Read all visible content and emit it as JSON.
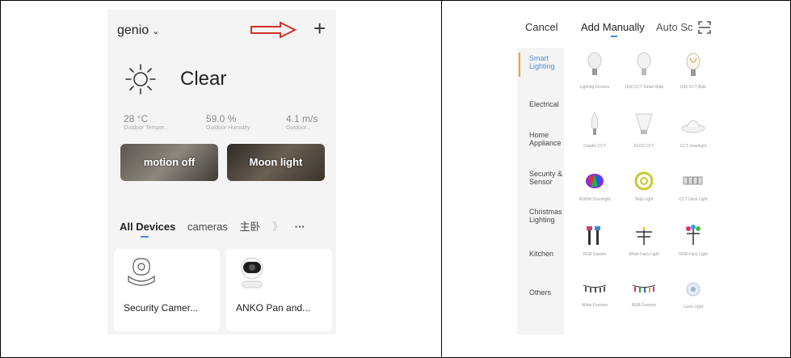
{
  "left_phone": {
    "home_name": "genio",
    "add_icon": "plus-icon",
    "annotation_arrow_color": "#d0302a",
    "weather": {
      "icon": "sun-icon",
      "condition": "Clear"
    },
    "stats": [
      {
        "value": "28 °C",
        "label": "Outdoor Temper..."
      },
      {
        "value": "59.0 %",
        "label": "Outdoor Humidity"
      },
      {
        "value": "4.1 m/s",
        "label": "Outdoor..."
      }
    ],
    "scenes": [
      {
        "label": "motion off"
      },
      {
        "label": "Moon light"
      }
    ],
    "tabs": [
      "All Devices",
      "cameras",
      "主卧",
      "》",
      "···"
    ],
    "accent_color": "#3a8dde",
    "devices": [
      {
        "name": "Security Camer...",
        "icon": "camera-icon"
      },
      {
        "name": "ANKO Pan and...",
        "icon": "pan-tilt-camera-icon"
      }
    ]
  },
  "right_phone": {
    "top_bar": {
      "cancel": "Cancel",
      "active_tab": "Add Manually",
      "other_tab": "Auto Sc",
      "scan_icon": "scan-icon"
    },
    "categories": [
      {
        "label": "Smart Lighting",
        "active": true
      },
      {
        "label": "Electrical"
      },
      {
        "label": "Home Appliance"
      },
      {
        "label": "Security & Sensor"
      },
      {
        "label": "Christmas Lighting"
      },
      {
        "label": "Kitchen"
      },
      {
        "label": "Others"
      }
    ],
    "products": [
      {
        "label": "Lighting Devices",
        "icon": "bulb-icon"
      },
      {
        "label": "15W CCT Smart Bulb",
        "icon": "bulb-icon"
      },
      {
        "label": "G95 CCT Bulb",
        "icon": "filament-bulb-icon"
      },
      {
        "label": "Candle CCT",
        "icon": "candle-bulb-icon"
      },
      {
        "label": "GU10 CCT",
        "icon": "spot-bulb-icon"
      },
      {
        "label": "CCT downlight",
        "icon": "downlight-icon"
      },
      {
        "label": "RGBW Downlight",
        "icon": "rgb-downlight-icon"
      },
      {
        "label": "Strip Light",
        "icon": "strip-light-icon"
      },
      {
        "label": "CCT Deck Light",
        "icon": "deck-light-icon"
      },
      {
        "label": "RGB Garden",
        "icon": "garden-light-icon"
      },
      {
        "label": "White Fairy Light",
        "icon": "fairy-light-icon"
      },
      {
        "label": "RGB Fairy Light",
        "icon": "rgb-fairy-light-icon"
      },
      {
        "label": "White Festoon",
        "icon": "festoon-icon"
      },
      {
        "label": "RGB Festoon",
        "icon": "rgb-festoon-icon"
      },
      {
        "label": "Laser Light",
        "icon": "laser-light-icon"
      }
    ]
  }
}
